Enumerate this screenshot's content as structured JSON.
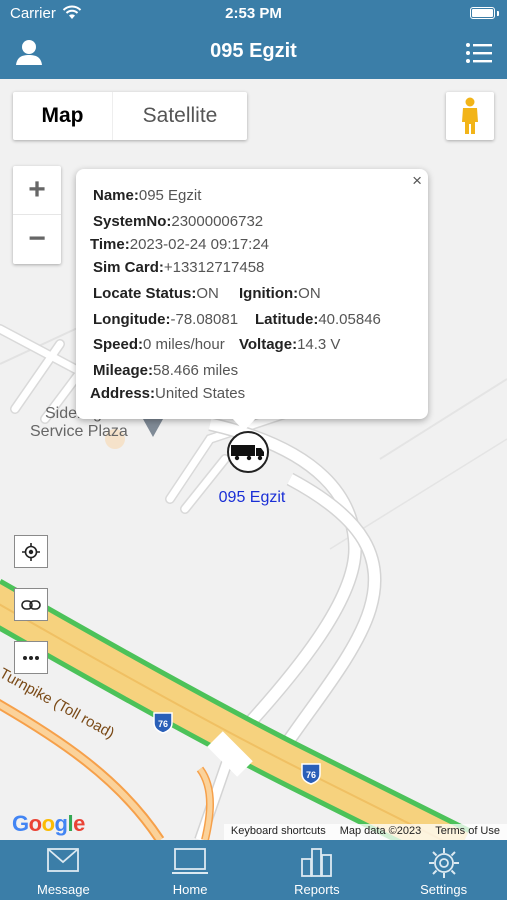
{
  "status_bar": {
    "carrier": "Carrier",
    "time": "2:53 PM"
  },
  "nav": {
    "title": "095 Egzit"
  },
  "map_controls": {
    "map_label": "Map",
    "satellite_label": "Satellite",
    "zoom_in": "+",
    "zoom_out": "−"
  },
  "info_window": {
    "name_label": "Name:",
    "name_value": "095 Egzit",
    "system_label": "SystemNo:",
    "system_value": "23000006732",
    "time_label": "Time:",
    "time_value": "2023-02-24 09:17:24",
    "sim_label": "Sim Card:",
    "sim_value": "+13312717458",
    "locate_label": "Locate Status:",
    "locate_value": "ON",
    "ignition_label": "Ignition:",
    "ignition_value": "ON",
    "longitude_label": "Longitude:",
    "longitude_value": "-78.08081",
    "latitude_label": "Latitude:",
    "latitude_value": "40.05846",
    "speed_label": "Speed:",
    "speed_value": "0 miles/hour",
    "voltage_label": "Voltage:",
    "voltage_value": "14.3 V",
    "mileage_label": "Mileage:",
    "mileage_value": "58.466 miles",
    "address_label": "Address:",
    "address_value": "United States",
    "close": "×"
  },
  "map": {
    "poi_line1": "Sideling Hill",
    "poi_line2": "Service Plaza",
    "road_label": "a Turnpike (Toll road)",
    "shield_1": "76",
    "shield_2": "76",
    "vehicle_label": "095 Egzit",
    "google": [
      "G",
      "o",
      "o",
      "g",
      "l",
      "e"
    ],
    "google_colors": [
      "#4285F4",
      "#EA4335",
      "#FBBC05",
      "#4285F4",
      "#34A853",
      "#EA4335"
    ],
    "footer": {
      "shortcuts": "Keyboard shortcuts",
      "map_data": "Map data ©2023",
      "terms": "Terms of Use"
    }
  },
  "tabs": [
    {
      "label": "Message",
      "icon": "message-icon"
    },
    {
      "label": "Home",
      "icon": "home-icon"
    },
    {
      "label": "Reports",
      "icon": "reports-icon"
    },
    {
      "label": "Settings",
      "icon": "settings-icon"
    }
  ],
  "colors": {
    "header": "#3b7ea8",
    "vehicle_label": "#1a2fd6",
    "highway_fill": "#f6d27e",
    "highway_traffic": "#4cc259"
  }
}
